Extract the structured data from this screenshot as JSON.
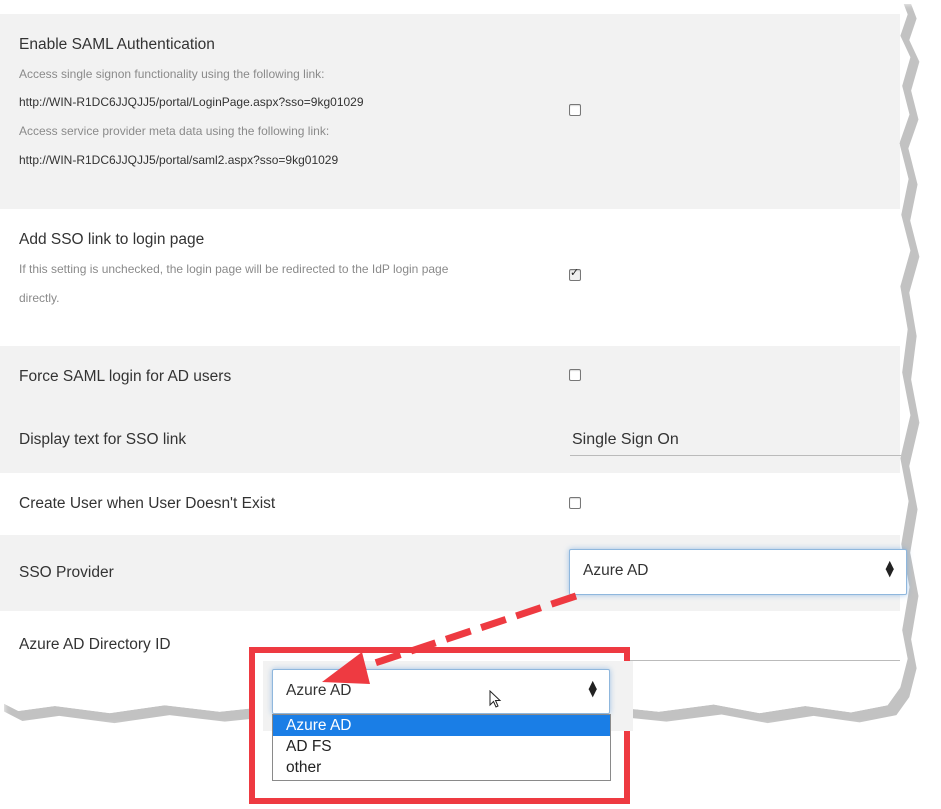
{
  "settings": {
    "saml": {
      "label": "Enable SAML Authentication",
      "hint1": "Access single signon functionality using the following link:",
      "link1": "http://WIN-R1DC6JJQJJ5/portal/LoginPage.aspx?sso=9kg01029",
      "hint2": "Access service provider meta data using the following link:",
      "link2": "http://WIN-R1DC6JJQJJ5/portal/saml2.aspx?sso=9kg01029",
      "checked": false
    },
    "sso_link": {
      "label": "Add SSO link to login page",
      "hint_line1": "If this setting is unchecked, the login page will be redirected to the IdP login page",
      "hint_line2": "directly.",
      "checked": true
    },
    "force_saml": {
      "label": "Force SAML login for AD users",
      "checked": false
    },
    "display_text": {
      "label": "Display text for SSO link",
      "value": "Single Sign On"
    },
    "create_user": {
      "label": "Create User when User Doesn't Exist",
      "checked": false
    },
    "sso_provider": {
      "label": "SSO Provider",
      "value": "Azure AD"
    },
    "azure_directory": {
      "label": "Azure AD Directory ID"
    }
  },
  "callout": {
    "select_value": "Azure AD",
    "options": [
      "Azure AD",
      "AD FS",
      "other"
    ],
    "selected_index": 0
  },
  "icons": {
    "checkmark": "checkmark-icon",
    "select_arrows": "updown-arrows-icon",
    "cursor": "mouse-cursor-icon"
  },
  "colors": {
    "callout_border": "#ee3a41",
    "selected_option": "#1a7ee6",
    "focus_glow": "#8fb7dd"
  }
}
